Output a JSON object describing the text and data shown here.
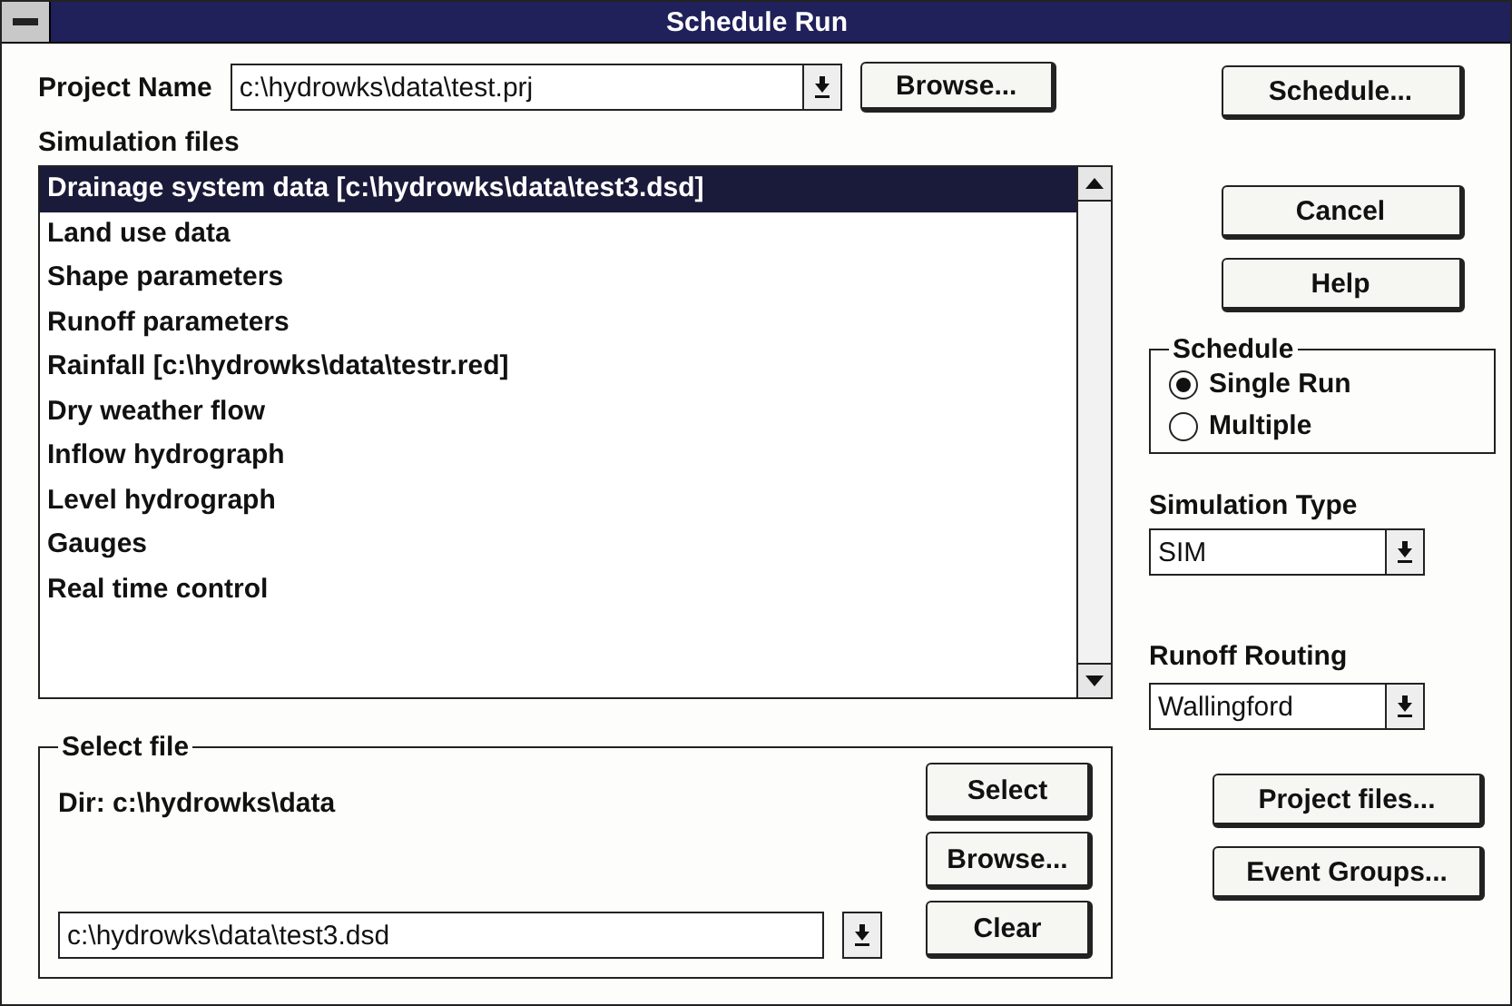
{
  "window": {
    "title": "Schedule Run"
  },
  "project": {
    "label": "Project Name",
    "value": "c:\\hydrowks\\data\\test.prj",
    "browse": "Browse..."
  },
  "simulation_files": {
    "label": "Simulation files",
    "items": [
      {
        "label": "Drainage system data  [c:\\hydrowks\\data\\test3.dsd]",
        "selected": true
      },
      {
        "label": "Land use data",
        "selected": false
      },
      {
        "label": "Shape parameters",
        "selected": false
      },
      {
        "label": "Runoff parameters",
        "selected": false
      },
      {
        "label": "Rainfall  [c:\\hydrowks\\data\\testr.red]",
        "selected": false
      },
      {
        "label": "Dry weather flow",
        "selected": false
      },
      {
        "label": "Inflow hydrograph",
        "selected": false
      },
      {
        "label": "Level hydrograph",
        "selected": false
      },
      {
        "label": "Gauges",
        "selected": false
      },
      {
        "label": "Real time control",
        "selected": false
      }
    ]
  },
  "select_file": {
    "title": "Select file",
    "dir": "Dir: c:\\hydrowks\\data",
    "value": "c:\\hydrowks\\data\\test3.dsd",
    "buttons": [
      "Select",
      "Browse...",
      "Clear"
    ]
  },
  "actions": [
    "Schedule...",
    "Cancel",
    "Help"
  ],
  "schedule": {
    "title": "Schedule",
    "options": [
      {
        "label": "Single Run",
        "selected": true
      },
      {
        "label": "Multiple",
        "selected": false
      }
    ]
  },
  "simulation_type": {
    "label": "Simulation Type",
    "value": "SIM"
  },
  "runoff_routing": {
    "label": "Runoff Routing",
    "value": "Wallingford"
  },
  "bottom_buttons": [
    "Project files...",
    "Event Groups..."
  ]
}
